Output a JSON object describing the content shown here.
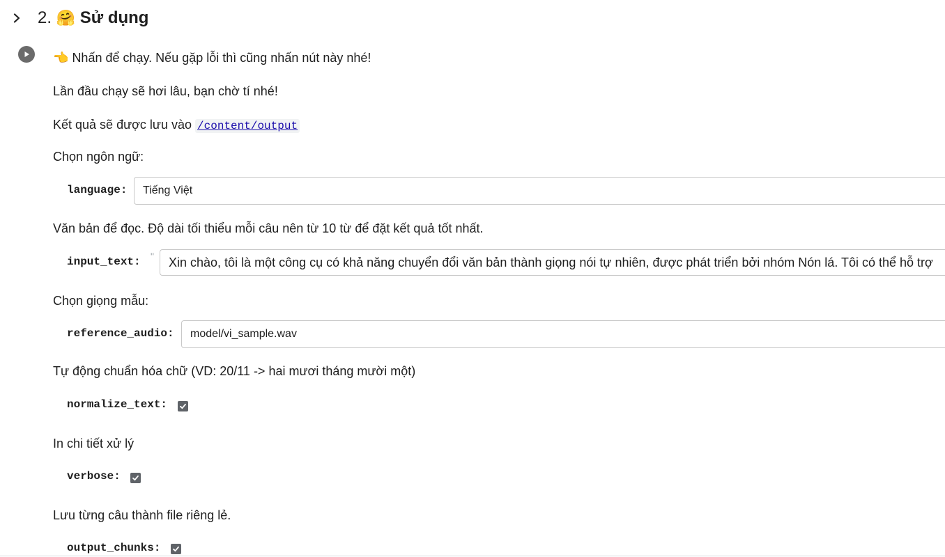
{
  "section": {
    "number": "2.",
    "emoji": "🤗",
    "title": "Sử dụng"
  },
  "cell": {
    "run_hint_emoji": "👈",
    "run_hint": "Nhấn để chạy. Nếu gặp lỗi thì cũng nhấn nút này nhé!",
    "first_run_note": "Lần đầu chạy sẽ hơi lâu, bạn chờ tí nhé!",
    "output_note_prefix": "Kết quả sẽ được lưu vào",
    "output_path": "/content/output"
  },
  "form": {
    "language": {
      "description": "Chọn ngôn ngữ:",
      "label": "language:",
      "value": "Tiếng Việt"
    },
    "input_text": {
      "description": "Văn bản để đọc. Độ dài tối thiểu mỗi câu nên từ 10 từ để đặt kết quả tốt nhất.",
      "label": "input_text:",
      "quote": "\"",
      "value": "Xin chào, tôi là một công cụ có khả năng chuyển đổi văn bản thành giọng nói tự nhiên, được phát triển bởi nhóm Nón lá. Tôi có thể hỗ trợ"
    },
    "reference_audio": {
      "description": "Chọn giọng mẫu:",
      "label": "reference_audio:",
      "value": "model/vi_sample.wav"
    },
    "normalize_text": {
      "description": "Tự động chuẩn hóa chữ (VD: 20/11 -> hai mươi tháng mười một)",
      "label": "normalize_text:",
      "checked": true
    },
    "verbose": {
      "description": "In chi tiết xử lý",
      "label": "verbose:",
      "checked": true
    },
    "output_chunks": {
      "description": "Lưu từng câu thành file riêng lẻ.",
      "label": "output_chunks:",
      "checked": true
    }
  },
  "icons": {
    "collapse": "chevron-right-icon",
    "run": "play-circle-icon",
    "checkbox": "check-icon"
  },
  "colors": {
    "link": "#1a0dab",
    "checkbox": "#5f6368",
    "run_button": "#6b6b6b",
    "input_border": "#c8c8c8"
  }
}
